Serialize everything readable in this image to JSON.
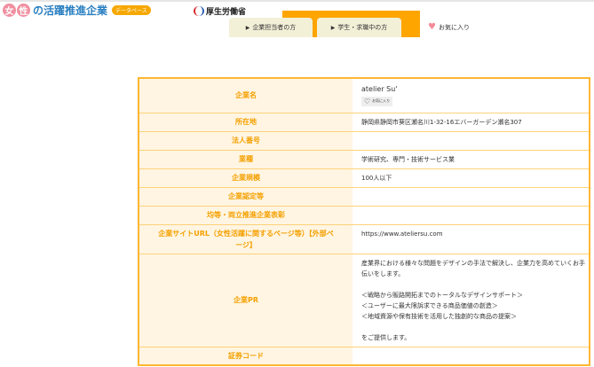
{
  "header": {
    "logo_char1": "女",
    "logo_char2": "性",
    "logo_text": "の活躍推進企業",
    "logo_badge": "データベース",
    "ministry": "厚生労働省",
    "tabs": [
      "企業担当者の方",
      "学生・求職中の方"
    ],
    "favorites": "お気に入り"
  },
  "company": {
    "favorite_button": "お気に入り",
    "rows": [
      {
        "label": "企業名",
        "value": "atelier Su'"
      },
      {
        "label": "所在地",
        "value": "静岡県静岡市葵区瀬名川1-32-16エバーガーデン瀬名307"
      },
      {
        "label": "法人番号",
        "value": ""
      },
      {
        "label": "業種",
        "value": "学術研究、専門・技術サービス業"
      },
      {
        "label": "企業規模",
        "value": "100人以下"
      },
      {
        "label": "企業認定等",
        "value": ""
      },
      {
        "label": "均等・両立推進企業表彰",
        "value": ""
      },
      {
        "label": "企業サイトURL（女性活躍に関するページ等）【外部ページ】",
        "value": "https://www.ateliersu.com"
      },
      {
        "label": "企業PR",
        "value": "産業界における様々な問題をデザインの手法で解決し、企業力を高めていくお手伝いをします。\n\n＜戦略から販路開拓までのトータルなデザインサポート＞\n＜ユーザーに最大限訴求できる商品価値の創造＞\n＜地域資源や保有技術を活用した独創的な商品の提案＞\n\nをご提供します。"
      },
      {
        "label": "証券コード",
        "value": ""
      }
    ]
  }
}
